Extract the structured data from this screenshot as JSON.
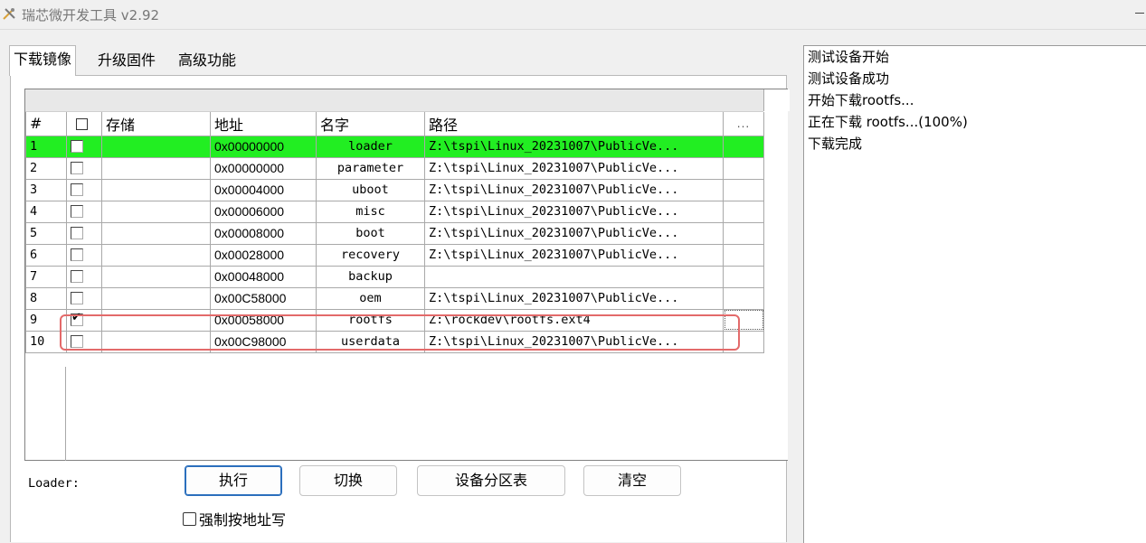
{
  "window": {
    "title": "瑞芯微开发工具 v2.92"
  },
  "tabs": [
    {
      "label": "下载镜像",
      "active": true
    },
    {
      "label": "升级固件",
      "active": false
    },
    {
      "label": "高级功能",
      "active": false
    }
  ],
  "partition_table": {
    "headers": {
      "num": "#",
      "store": "存储",
      "address": "地址",
      "name": "名字",
      "path": "路径",
      "more": "..."
    },
    "rows": [
      {
        "num": "1",
        "checked": false,
        "store": "",
        "address": "0x00000000",
        "name": "loader",
        "path": "Z:\\tspi\\Linux_20231007\\PublicVe...",
        "highlighted": true
      },
      {
        "num": "2",
        "checked": false,
        "store": "",
        "address": "0x00000000",
        "name": "parameter",
        "path": "Z:\\tspi\\Linux_20231007\\PublicVe..."
      },
      {
        "num": "3",
        "checked": false,
        "store": "",
        "address": "0x00004000",
        "name": "uboot",
        "path": "Z:\\tspi\\Linux_20231007\\PublicVe..."
      },
      {
        "num": "4",
        "checked": false,
        "store": "",
        "address": "0x00006000",
        "name": "misc",
        "path": "Z:\\tspi\\Linux_20231007\\PublicVe..."
      },
      {
        "num": "5",
        "checked": false,
        "store": "",
        "address": "0x00008000",
        "name": "boot",
        "path": "Z:\\tspi\\Linux_20231007\\PublicVe..."
      },
      {
        "num": "6",
        "checked": false,
        "store": "",
        "address": "0x00028000",
        "name": "recovery",
        "path": "Z:\\tspi\\Linux_20231007\\PublicVe..."
      },
      {
        "num": "7",
        "checked": false,
        "store": "",
        "address": "0x00048000",
        "name": "backup",
        "path": ""
      },
      {
        "num": "8",
        "checked": false,
        "store": "",
        "address": "0x00C58000",
        "name": "oem",
        "path": "Z:\\tspi\\Linux_20231007\\PublicVe..."
      },
      {
        "num": "9",
        "checked": true,
        "store": "",
        "address": "0x00058000",
        "name": "rootfs",
        "path": "Z:\\rockdev\\rootfs.ext4"
      },
      {
        "num": "10",
        "checked": false,
        "store": "",
        "address": "0x00C98000",
        "name": "userdata",
        "path": "Z:\\tspi\\Linux_20231007\\PublicVe..."
      }
    ]
  },
  "bottom": {
    "loader_label": "Loader:",
    "execute_label": "执行",
    "switch_label": "切换",
    "partition_table_label": "设备分区表",
    "clear_label": "清空",
    "force_address_label": "强制按地址写"
  },
  "log": {
    "lines": [
      "测试设备开始",
      "测试设备成功",
      "开始下载rootfs...",
      "正在下载 rootfs...(100%)",
      "下载完成"
    ]
  },
  "colors": {
    "highlight_row": "#22ee22",
    "annotation_box": "#e36a6a"
  }
}
